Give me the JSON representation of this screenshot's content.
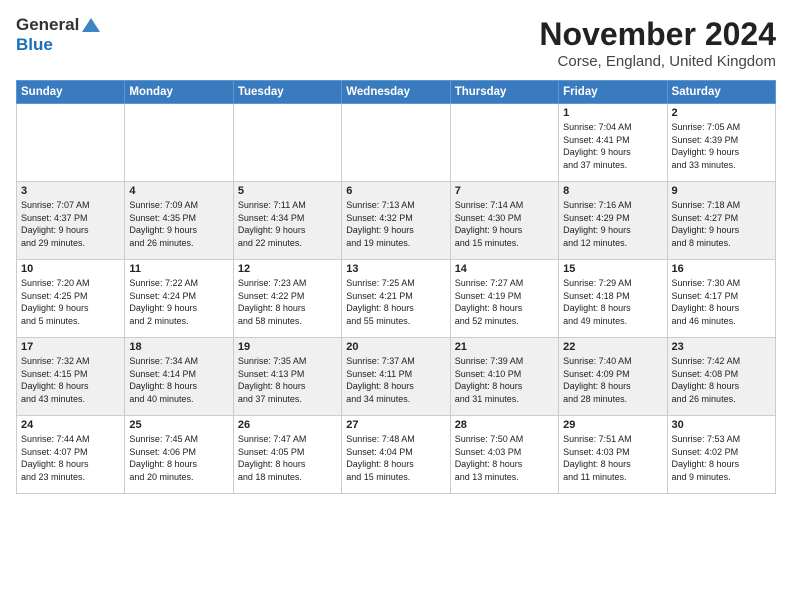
{
  "header": {
    "logo_general": "General",
    "logo_blue": "Blue",
    "title": "November 2024",
    "subtitle": "Corse, England, United Kingdom"
  },
  "weekdays": [
    "Sunday",
    "Monday",
    "Tuesday",
    "Wednesday",
    "Thursday",
    "Friday",
    "Saturday"
  ],
  "weeks": [
    [
      {
        "day": "",
        "info": ""
      },
      {
        "day": "",
        "info": ""
      },
      {
        "day": "",
        "info": ""
      },
      {
        "day": "",
        "info": ""
      },
      {
        "day": "",
        "info": ""
      },
      {
        "day": "1",
        "info": "Sunrise: 7:04 AM\nSunset: 4:41 PM\nDaylight: 9 hours\nand 37 minutes."
      },
      {
        "day": "2",
        "info": "Sunrise: 7:05 AM\nSunset: 4:39 PM\nDaylight: 9 hours\nand 33 minutes."
      }
    ],
    [
      {
        "day": "3",
        "info": "Sunrise: 7:07 AM\nSunset: 4:37 PM\nDaylight: 9 hours\nand 29 minutes."
      },
      {
        "day": "4",
        "info": "Sunrise: 7:09 AM\nSunset: 4:35 PM\nDaylight: 9 hours\nand 26 minutes."
      },
      {
        "day": "5",
        "info": "Sunrise: 7:11 AM\nSunset: 4:34 PM\nDaylight: 9 hours\nand 22 minutes."
      },
      {
        "day": "6",
        "info": "Sunrise: 7:13 AM\nSunset: 4:32 PM\nDaylight: 9 hours\nand 19 minutes."
      },
      {
        "day": "7",
        "info": "Sunrise: 7:14 AM\nSunset: 4:30 PM\nDaylight: 9 hours\nand 15 minutes."
      },
      {
        "day": "8",
        "info": "Sunrise: 7:16 AM\nSunset: 4:29 PM\nDaylight: 9 hours\nand 12 minutes."
      },
      {
        "day": "9",
        "info": "Sunrise: 7:18 AM\nSunset: 4:27 PM\nDaylight: 9 hours\nand 8 minutes."
      }
    ],
    [
      {
        "day": "10",
        "info": "Sunrise: 7:20 AM\nSunset: 4:25 PM\nDaylight: 9 hours\nand 5 minutes."
      },
      {
        "day": "11",
        "info": "Sunrise: 7:22 AM\nSunset: 4:24 PM\nDaylight: 9 hours\nand 2 minutes."
      },
      {
        "day": "12",
        "info": "Sunrise: 7:23 AM\nSunset: 4:22 PM\nDaylight: 8 hours\nand 58 minutes."
      },
      {
        "day": "13",
        "info": "Sunrise: 7:25 AM\nSunset: 4:21 PM\nDaylight: 8 hours\nand 55 minutes."
      },
      {
        "day": "14",
        "info": "Sunrise: 7:27 AM\nSunset: 4:19 PM\nDaylight: 8 hours\nand 52 minutes."
      },
      {
        "day": "15",
        "info": "Sunrise: 7:29 AM\nSunset: 4:18 PM\nDaylight: 8 hours\nand 49 minutes."
      },
      {
        "day": "16",
        "info": "Sunrise: 7:30 AM\nSunset: 4:17 PM\nDaylight: 8 hours\nand 46 minutes."
      }
    ],
    [
      {
        "day": "17",
        "info": "Sunrise: 7:32 AM\nSunset: 4:15 PM\nDaylight: 8 hours\nand 43 minutes."
      },
      {
        "day": "18",
        "info": "Sunrise: 7:34 AM\nSunset: 4:14 PM\nDaylight: 8 hours\nand 40 minutes."
      },
      {
        "day": "19",
        "info": "Sunrise: 7:35 AM\nSunset: 4:13 PM\nDaylight: 8 hours\nand 37 minutes."
      },
      {
        "day": "20",
        "info": "Sunrise: 7:37 AM\nSunset: 4:11 PM\nDaylight: 8 hours\nand 34 minutes."
      },
      {
        "day": "21",
        "info": "Sunrise: 7:39 AM\nSunset: 4:10 PM\nDaylight: 8 hours\nand 31 minutes."
      },
      {
        "day": "22",
        "info": "Sunrise: 7:40 AM\nSunset: 4:09 PM\nDaylight: 8 hours\nand 28 minutes."
      },
      {
        "day": "23",
        "info": "Sunrise: 7:42 AM\nSunset: 4:08 PM\nDaylight: 8 hours\nand 26 minutes."
      }
    ],
    [
      {
        "day": "24",
        "info": "Sunrise: 7:44 AM\nSunset: 4:07 PM\nDaylight: 8 hours\nand 23 minutes."
      },
      {
        "day": "25",
        "info": "Sunrise: 7:45 AM\nSunset: 4:06 PM\nDaylight: 8 hours\nand 20 minutes."
      },
      {
        "day": "26",
        "info": "Sunrise: 7:47 AM\nSunset: 4:05 PM\nDaylight: 8 hours\nand 18 minutes."
      },
      {
        "day": "27",
        "info": "Sunrise: 7:48 AM\nSunset: 4:04 PM\nDaylight: 8 hours\nand 15 minutes."
      },
      {
        "day": "28",
        "info": "Sunrise: 7:50 AM\nSunset: 4:03 PM\nDaylight: 8 hours\nand 13 minutes."
      },
      {
        "day": "29",
        "info": "Sunrise: 7:51 AM\nSunset: 4:03 PM\nDaylight: 8 hours\nand 11 minutes."
      },
      {
        "day": "30",
        "info": "Sunrise: 7:53 AM\nSunset: 4:02 PM\nDaylight: 8 hours\nand 9 minutes."
      }
    ]
  ]
}
